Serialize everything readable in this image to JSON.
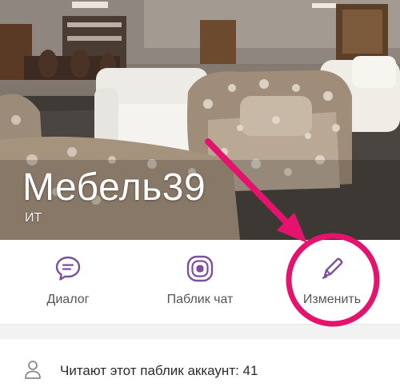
{
  "header": {
    "title": "Мебель39",
    "subtitle": "ИТ"
  },
  "actions": [
    {
      "label": "Диалог",
      "icon": "chat-bubble-icon"
    },
    {
      "label": "Паблик чат",
      "icon": "public-chat-icon"
    },
    {
      "label": "Изменить",
      "icon": "pencil-icon"
    }
  ],
  "followers": {
    "text": "Читают этот паблик аккаунт: 41",
    "icon": "person-icon"
  },
  "colors": {
    "accent": "#7b519d",
    "annotation": "#e5136e"
  }
}
